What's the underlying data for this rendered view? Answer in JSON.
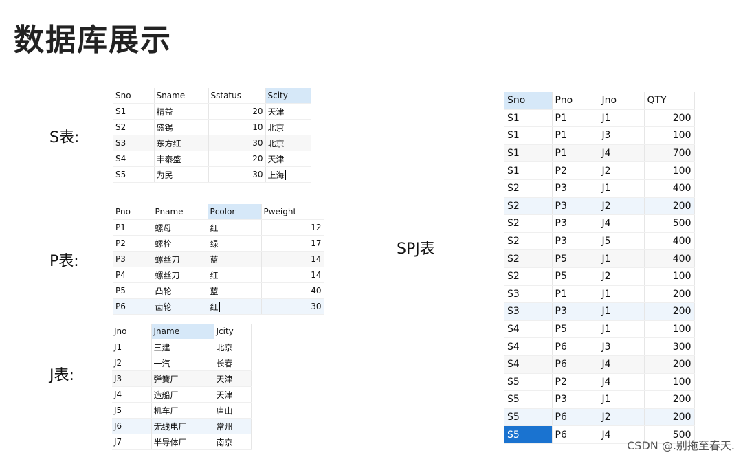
{
  "title": "数据库展示",
  "labels": {
    "s": "S表:",
    "p": "P表:",
    "j": "J表:",
    "spj": "SPJ表"
  },
  "watermark": "CSDN @.别拖至春天.",
  "colors": {
    "header_highlight": "#d6e8f8",
    "selected_cell": "#1a73d0"
  },
  "s_table": {
    "columns": [
      "Sno",
      "Sname",
      "Sstatus",
      "Scity"
    ],
    "rows": [
      [
        "S1",
        "精益",
        "20",
        "天津"
      ],
      [
        "S2",
        "盛锡",
        "10",
        "北京"
      ],
      [
        "S3",
        "东方红",
        "30",
        "北京"
      ],
      [
        "S4",
        "丰泰盛",
        "20",
        "天津"
      ],
      [
        "S5",
        "为民",
        "30",
        "上海"
      ]
    ]
  },
  "p_table": {
    "columns": [
      "Pno",
      "Pname",
      "Pcolor",
      "Pweight"
    ],
    "rows": [
      [
        "P1",
        "螺母",
        "红",
        "12"
      ],
      [
        "P2",
        "螺栓",
        "绿",
        "17"
      ],
      [
        "P3",
        "螺丝刀",
        "蓝",
        "14"
      ],
      [
        "P4",
        "螺丝刀",
        "红",
        "14"
      ],
      [
        "P5",
        "凸轮",
        "蓝",
        "40"
      ],
      [
        "P6",
        "齿轮",
        "红",
        "30"
      ]
    ]
  },
  "j_table": {
    "columns": [
      "Jno",
      "Jname",
      "Jcity"
    ],
    "rows": [
      [
        "J1",
        "三建",
        "北京"
      ],
      [
        "J2",
        "一汽",
        "长春"
      ],
      [
        "J3",
        "弹簧厂",
        "天津"
      ],
      [
        "J4",
        "造船厂",
        "天津"
      ],
      [
        "J5",
        "机车厂",
        "唐山"
      ],
      [
        "J6",
        "无线电厂",
        "常州"
      ],
      [
        "J7",
        "半导体厂",
        "南京"
      ]
    ]
  },
  "spj_table": {
    "columns": [
      "Sno",
      "Pno",
      "Jno",
      "QTY"
    ],
    "rows": [
      [
        "S1",
        "P1",
        "J1",
        "200"
      ],
      [
        "S1",
        "P1",
        "J3",
        "100"
      ],
      [
        "S1",
        "P1",
        "J4",
        "700"
      ],
      [
        "S1",
        "P2",
        "J2",
        "100"
      ],
      [
        "S2",
        "P3",
        "J1",
        "400"
      ],
      [
        "S2",
        "P3",
        "J2",
        "200"
      ],
      [
        "S2",
        "P3",
        "J4",
        "500"
      ],
      [
        "S2",
        "P3",
        "J5",
        "400"
      ],
      [
        "S2",
        "P5",
        "J1",
        "400"
      ],
      [
        "S2",
        "P5",
        "J2",
        "100"
      ],
      [
        "S3",
        "P1",
        "J1",
        "200"
      ],
      [
        "S3",
        "P3",
        "J1",
        "200"
      ],
      [
        "S4",
        "P5",
        "J1",
        "100"
      ],
      [
        "S4",
        "P6",
        "J3",
        "300"
      ],
      [
        "S4",
        "P6",
        "J4",
        "200"
      ],
      [
        "S5",
        "P2",
        "J4",
        "100"
      ],
      [
        "S5",
        "P3",
        "J1",
        "200"
      ],
      [
        "S5",
        "P6",
        "J2",
        "200"
      ],
      [
        "S5",
        "P6",
        "J4",
        "500"
      ]
    ]
  }
}
